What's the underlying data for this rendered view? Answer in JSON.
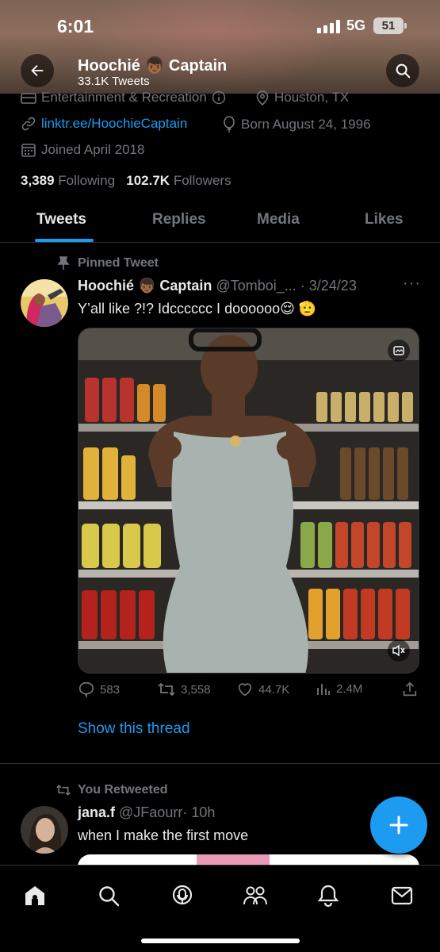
{
  "status_bar": {
    "time": "6:01",
    "network": "5G",
    "battery": "51"
  },
  "header": {
    "name": "Hoochié 👦🏾 Captain",
    "tweets_count": "33.1K Tweets"
  },
  "profile": {
    "category": "Entertainment & Recreation",
    "location": "Houston, TX",
    "website": "linktr.ee/HoochieCaptain",
    "birthday": "Born August 24, 1996",
    "joined": "Joined April 2018",
    "following_count": "3,389",
    "following_label": "Following",
    "followers_count": "102.7K",
    "followers_label": "Followers"
  },
  "tabs": [
    {
      "label": "Tweets",
      "active": true
    },
    {
      "label": "Replies"
    },
    {
      "label": "Media"
    },
    {
      "label": "Likes"
    }
  ],
  "pinned_tweet": {
    "context": "Pinned Tweet",
    "author_name": "Hoochié 👦🏾 Captain",
    "handle": "@Tomboi_...",
    "date": "· 3/24/23",
    "text": "Y’all like ?!? Idcccccc I doooooo😌 🫡",
    "stats": {
      "replies": "583",
      "retweets": "3,558",
      "likes": "44.7K",
      "views": "2.4M"
    },
    "show_thread": "Show this thread"
  },
  "retweet": {
    "context": "You Retweeted",
    "author_name": "jana.f",
    "handle": "@JFaourr",
    "time": "· 10h",
    "text": "when I make the first move"
  },
  "colors": {
    "accent": "#1d9bf0",
    "background": "#000000",
    "muted": "#71767b",
    "text": "#e7e9ea"
  },
  "icons": {
    "back": "arrow-left-icon",
    "search": "search-icon",
    "category": "briefcase-icon",
    "location": "location-pin-icon",
    "link": "link-icon",
    "birthday": "balloon-icon",
    "calendar": "calendar-icon",
    "pin": "pin-icon",
    "reply": "reply-icon",
    "retweet": "retweet-icon",
    "like": "heart-icon",
    "views": "views-icon",
    "share": "share-icon",
    "compose": "plus-icon",
    "nav": [
      "home-icon",
      "search-icon",
      "spaces-icon",
      "communities-icon",
      "notifications-icon",
      "messages-icon"
    ]
  }
}
